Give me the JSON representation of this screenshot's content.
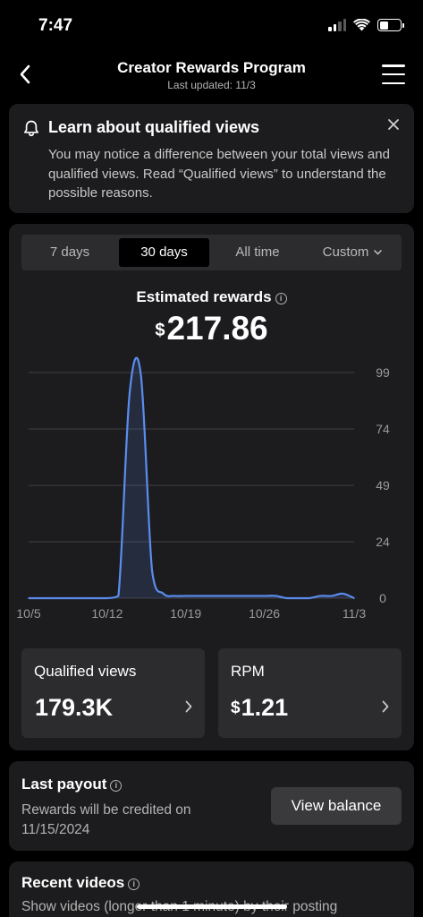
{
  "status_bar": {
    "time": "7:47"
  },
  "nav": {
    "title": "Creator Rewards Program",
    "subtitle": "Last updated: 11/3"
  },
  "banner": {
    "title": "Learn about qualified views",
    "text": "You may notice a difference between your total views and qualified views. Read “Qualified views” to understand the possible reasons."
  },
  "range_tabs": [
    {
      "label": "7 days",
      "active": false
    },
    {
      "label": "30 days",
      "active": true
    },
    {
      "label": "All time",
      "active": false
    },
    {
      "label": "Custom",
      "active": false
    }
  ],
  "rewards": {
    "label": "Estimated rewards",
    "currency": "$",
    "amount": "217.86"
  },
  "chart_data": {
    "type": "area",
    "x_tick_labels": [
      "10/5",
      "10/12",
      "10/19",
      "10/26",
      "11/3"
    ],
    "y_tick_labels": [
      "99",
      "74",
      "49",
      "24",
      "0"
    ],
    "ylim": [
      0,
      99
    ],
    "grid": true,
    "line_color": "#5b8def",
    "x": [
      "10/5",
      "10/6",
      "10/7",
      "10/8",
      "10/9",
      "10/10",
      "10/11",
      "10/12",
      "10/13",
      "10/14",
      "10/15",
      "10/16",
      "10/17",
      "10/18",
      "10/19",
      "10/20",
      "10/21",
      "10/22",
      "10/23",
      "10/24",
      "10/25",
      "10/26",
      "10/27",
      "10/28",
      "10/29",
      "10/30",
      "10/31",
      "11/1",
      "11/2",
      "11/3"
    ],
    "values": [
      0,
      0,
      0,
      0,
      0,
      0,
      0,
      0,
      1,
      90,
      98,
      12,
      2,
      1,
      1,
      1,
      1,
      1,
      1,
      1,
      1,
      1,
      1,
      0,
      0,
      0,
      1,
      1,
      2,
      0
    ]
  },
  "stats": [
    {
      "label": "Qualified views",
      "currency": "",
      "value": "179.3K"
    },
    {
      "label": "RPM",
      "currency": "$",
      "value": "1.21"
    }
  ],
  "payout": {
    "title": "Last payout",
    "text": "Rewards will be credited on 11/15/2024",
    "button_label": "View balance"
  },
  "recent_videos": {
    "title": "Recent videos",
    "text": "Show videos (longer than 1 minute) by their posting"
  }
}
